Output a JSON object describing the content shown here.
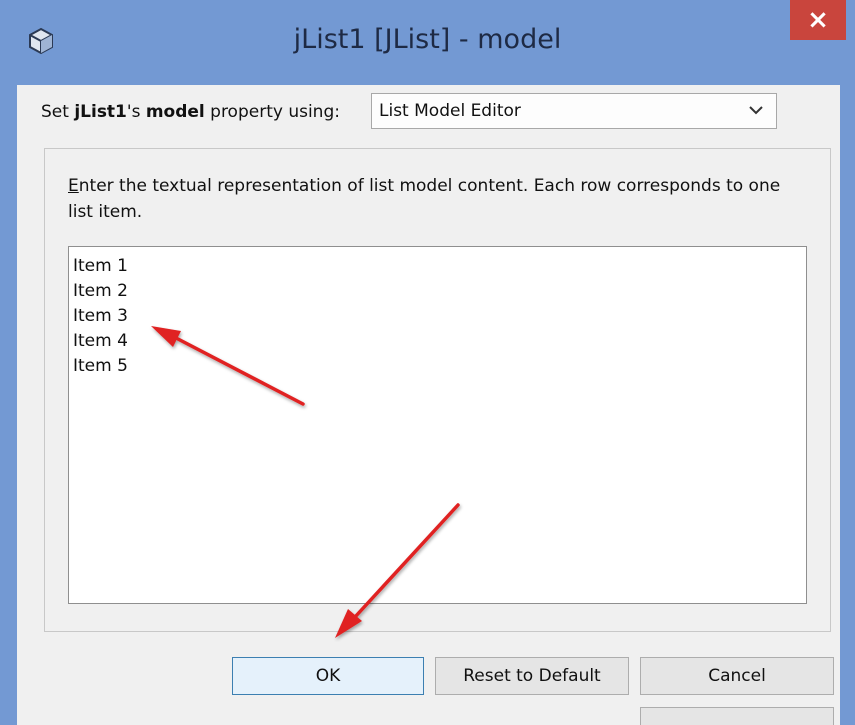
{
  "window": {
    "title": "jList1 [JList] - model",
    "close_label": "×",
    "app_icon": "netbeans-cube-icon"
  },
  "model_row": {
    "prefix": "Set ",
    "component": "jList1",
    "possessive": "'s ",
    "property": "model",
    "suffix": " property using:",
    "editor_selected": "List Model Editor",
    "dropdown_icon": "chevron-down-icon"
  },
  "panel": {
    "mnemonic": "E",
    "description": "nter the textual representation of list model content. Each row corresponds to one list item.",
    "items": [
      "Item 1",
      "Item 2",
      "Item 3",
      "Item 4",
      "Item 5"
    ]
  },
  "buttons": {
    "ok": "OK",
    "reset": "Reset to Default",
    "cancel": "Cancel"
  },
  "colors": {
    "title_bar": "#7399d3",
    "close_button": "#c9453d",
    "annotation_arrow": "#e02020",
    "ok_button_border": "#3c7fb1"
  }
}
